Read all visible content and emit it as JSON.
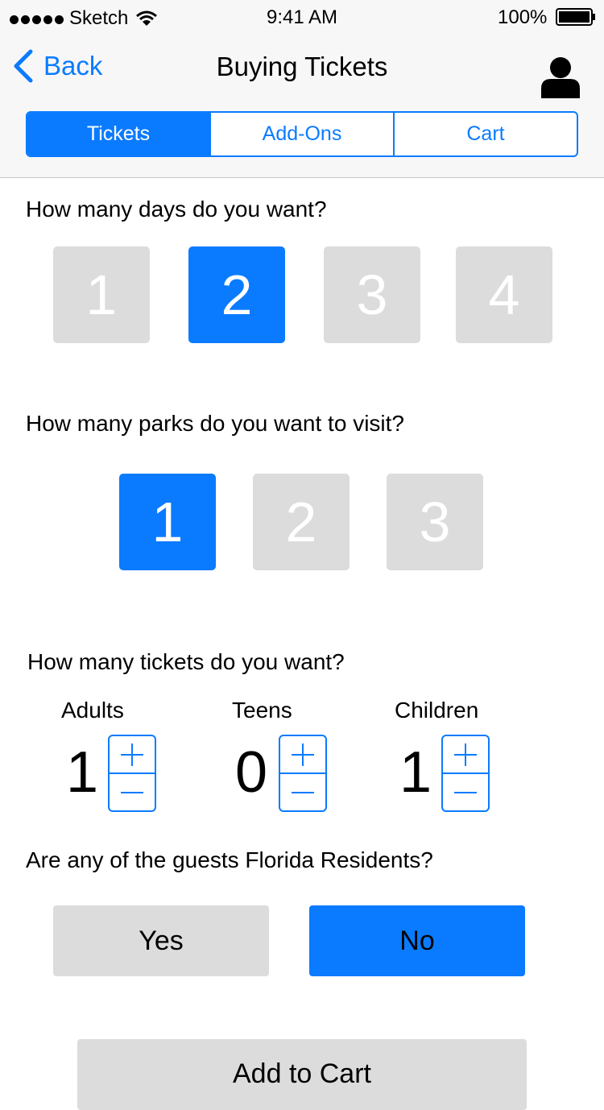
{
  "status_bar": {
    "carrier": "Sketch",
    "time": "9:41 AM",
    "battery": "100%"
  },
  "nav": {
    "back_label": "Back",
    "title": "Buying Tickets"
  },
  "tabs": [
    {
      "label": "Tickets",
      "active": true
    },
    {
      "label": "Add-Ons",
      "active": false
    },
    {
      "label": "Cart",
      "active": false
    }
  ],
  "days": {
    "question": "How many days do you want?",
    "options": [
      "1",
      "2",
      "3",
      "4"
    ],
    "selected": "2"
  },
  "parks": {
    "question": "How many parks do you want to visit?",
    "options": [
      "1",
      "2",
      "3"
    ],
    "selected": "1"
  },
  "tickets": {
    "question": "How many tickets do you want?",
    "adults": {
      "label": "Adults",
      "value": "1"
    },
    "teens": {
      "label": "Teens",
      "value": "0"
    },
    "children": {
      "label": "Children",
      "value": "1"
    }
  },
  "residents": {
    "question": "Are any of the guests Florida Residents?",
    "yes_label": "Yes",
    "no_label": "No",
    "selected": "No"
  },
  "add_to_cart": "Add to Cart",
  "colors": {
    "accent": "#0a7bff",
    "inactive": "#dcdcdc"
  }
}
